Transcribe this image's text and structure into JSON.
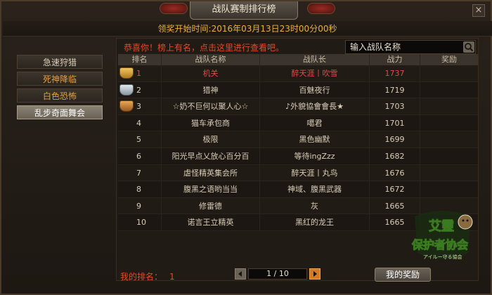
{
  "window": {
    "title": "战队赛制排行榜",
    "close": "×"
  },
  "time_bar": "领奖开始时间:2016年03月13日23时00分00秒",
  "sidebar": {
    "items": [
      {
        "label": "急速狩猎",
        "active": false
      },
      {
        "label": "死神降临",
        "active": false
      },
      {
        "label": "白色恐怖",
        "active": false
      },
      {
        "label": "乱步奇面舞会",
        "active": true
      }
    ]
  },
  "notice": "恭喜你！榜上有名，点击这里进行查看吧。",
  "search": {
    "placeholder": "输入战队名称"
  },
  "table": {
    "headers": {
      "rank": "排名",
      "team": "战队名称",
      "captain": "战队长",
      "power": "战力",
      "award": "奖励"
    },
    "rows": [
      {
        "rank": "1",
        "team": "机关",
        "captain": "醉天涯丨吹雪",
        "power": "1737",
        "trophy": "gold"
      },
      {
        "rank": "2",
        "team": "猎神",
        "captain": "百魅夜行",
        "power": "1719",
        "trophy": "silver"
      },
      {
        "rank": "3",
        "team": "☆奶不巨何以聚人心☆",
        "captain": "♪外貌協會會長★",
        "power": "1703",
        "trophy": "bronze"
      },
      {
        "rank": "4",
        "team": "猫车承包商",
        "captain": "噶君",
        "power": "1701",
        "trophy": ""
      },
      {
        "rank": "5",
        "team": "极限",
        "captain": "黑色幽默",
        "power": "1699",
        "trophy": ""
      },
      {
        "rank": "6",
        "team": "阳光早点乂放心百分百",
        "captain": "等待ingZzz",
        "power": "1682",
        "trophy": ""
      },
      {
        "rank": "7",
        "team": "虐怪精英集会所",
        "captain": "醉天涯丨丸鸟",
        "power": "1676",
        "trophy": ""
      },
      {
        "rank": "8",
        "team": "腹黑之语哟当当",
        "captain": "神域、腹黑武器",
        "power": "1672",
        "trophy": ""
      },
      {
        "rank": "9",
        "team": "修雷德",
        "captain": "灰",
        "power": "1665",
        "trophy": ""
      },
      {
        "rank": "10",
        "team": "诺言王立精英",
        "captain": "黑红的龙王",
        "power": "1665",
        "trophy": ""
      }
    ]
  },
  "footer": {
    "my_rank_label": "我的排名：",
    "my_rank_value": "1",
    "page": "1 / 10",
    "award_button": "我的奖励"
  },
  "watermark": {
    "line1": "艾靈",
    "line2": "保护者协会",
    "line3": "アイルー守る協会"
  },
  "colors": {
    "accent": "#e8b040",
    "highlight": "#e04a2a",
    "gold": "#f0c860"
  }
}
